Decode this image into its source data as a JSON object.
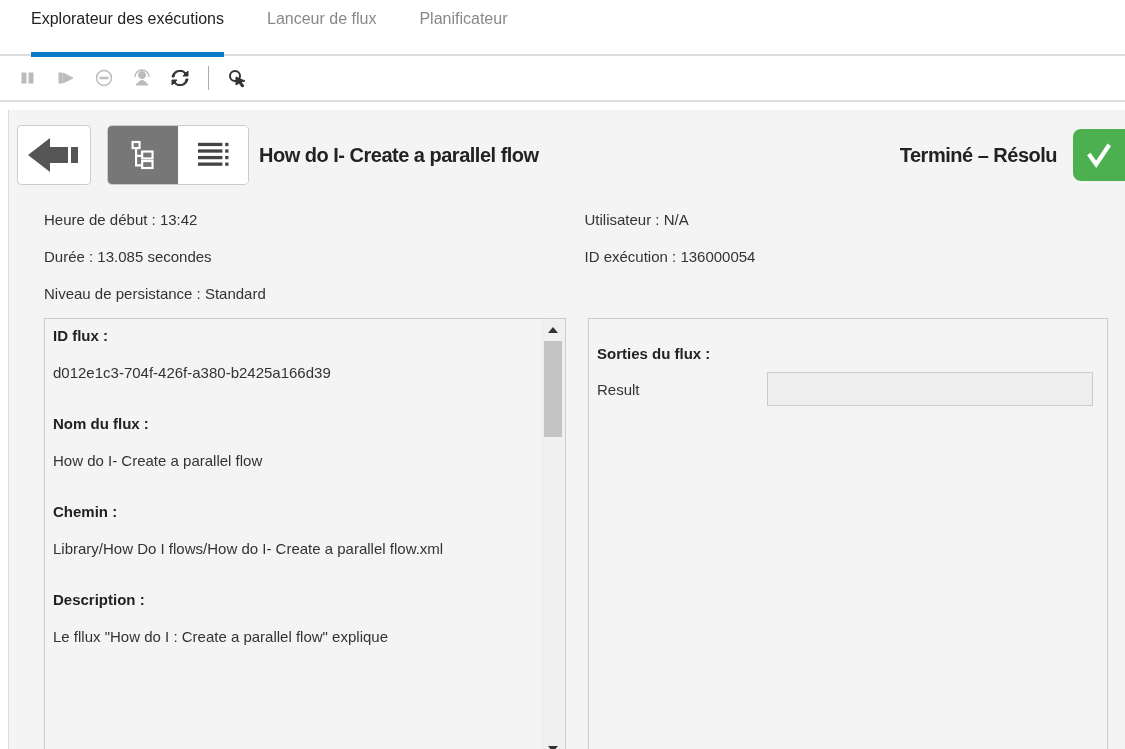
{
  "tabs": [
    {
      "label": "Explorateur des exécutions",
      "selected": true
    },
    {
      "label": "Lanceur de flux",
      "selected": false
    },
    {
      "label": "Planificateur",
      "selected": false
    }
  ],
  "toolbar": [
    {
      "kind": "pause",
      "disabled": true
    },
    {
      "kind": "resume",
      "disabled": true
    },
    {
      "kind": "cancel",
      "disabled": true
    },
    {
      "kind": "reassign",
      "disabled": true
    },
    {
      "kind": "refresh",
      "disabled": false
    },
    {
      "kind": "separator"
    },
    {
      "kind": "navigate",
      "disabled": false
    }
  ],
  "views": [
    {
      "kind": "tree",
      "selected": true
    },
    {
      "kind": "list",
      "selected": false
    }
  ],
  "flow_title": "How do I- Create a parallel flow",
  "status": {
    "label": "Terminé – Résolu",
    "kind": "success"
  },
  "info_left": [
    "Heure de début : 13:42",
    "Durée : 13.085 secondes",
    "Niveau de persistance : Standard"
  ],
  "info_right": [
    "Utilisateur : N/A",
    "ID exécution : 136000054"
  ],
  "details": [
    {
      "heading": "ID flux :",
      "value": "d012e1c3-704f-426f-a380-b2425a166d39"
    },
    {
      "heading": "Nom du flux :",
      "value": "How do I- Create a parallel flow"
    },
    {
      "heading": "Chemin :",
      "value": "Library/How Do I flows/How do I- Create a parallel flow.xml"
    },
    {
      "heading": "Description :",
      "value": "Le fllux \"How do I : Create a parallel flow\" explique"
    }
  ],
  "outputs": {
    "heading": "Sorties du flux :",
    "rows": [
      {
        "label": "Result",
        "value": ""
      }
    ]
  }
}
